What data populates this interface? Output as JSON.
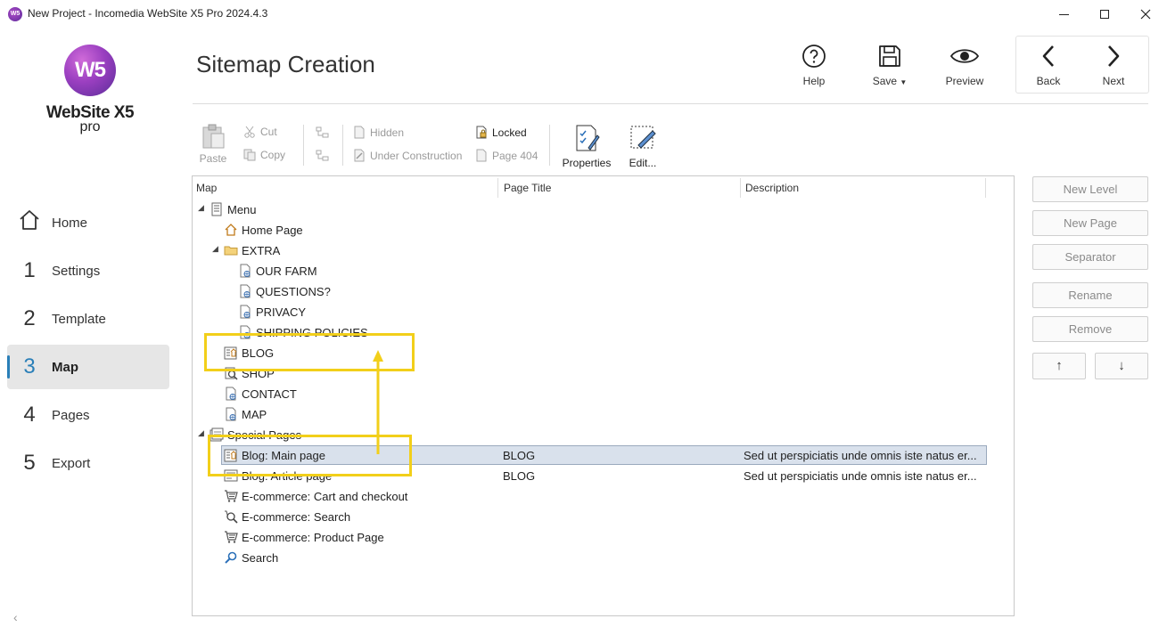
{
  "window": {
    "title": "New Project - Incomedia WebSite X5 Pro 2024.4.3",
    "app_icon": "W5"
  },
  "logo": {
    "mark": "W5",
    "name": "WebSite X5",
    "edition": "pro"
  },
  "nav": [
    {
      "num": "",
      "label": "Home",
      "icon": "home-icon"
    },
    {
      "num": "1",
      "label": "Settings"
    },
    {
      "num": "2",
      "label": "Template"
    },
    {
      "num": "3",
      "label": "Map",
      "active": true
    },
    {
      "num": "4",
      "label": "Pages"
    },
    {
      "num": "5",
      "label": "Export"
    }
  ],
  "header": {
    "title": "Sitemap Creation",
    "help": "Help",
    "save": "Save",
    "preview": "Preview",
    "back": "Back",
    "next": "Next"
  },
  "toolbar": {
    "paste": "Paste",
    "cut": "Cut",
    "copy": "Copy",
    "hidden": "Hidden",
    "under_construction": "Under Construction",
    "locked": "Locked",
    "page404": "Page 404",
    "properties": "Properties",
    "edit": "Edit..."
  },
  "tree": {
    "columns": [
      "Map",
      "Page Title",
      "Description"
    ],
    "rows": [
      {
        "label": "Menu",
        "title": "",
        "desc": "",
        "icon": "menu-root-icon",
        "twisty": true
      },
      {
        "label": "Home Page",
        "title": "",
        "desc": "",
        "icon": "home-page-icon"
      },
      {
        "label": "EXTRA",
        "title": "",
        "desc": "",
        "icon": "folder-icon",
        "twisty": true
      },
      {
        "label": "OUR FARM",
        "title": "",
        "desc": "",
        "icon": "page-icon"
      },
      {
        "label": "QUESTIONS?",
        "title": "",
        "desc": "",
        "icon": "page-icon"
      },
      {
        "label": "PRIVACY",
        "title": "",
        "desc": "",
        "icon": "page-icon"
      },
      {
        "label": "SHIPPING POLICIES",
        "title": "",
        "desc": "",
        "icon": "page-icon"
      },
      {
        "label": "BLOG",
        "title": "",
        "desc": "",
        "icon": "blog-page-icon"
      },
      {
        "label": "SHOP",
        "title": "",
        "desc": "",
        "icon": "shop-page-icon"
      },
      {
        "label": "CONTACT",
        "title": "",
        "desc": "",
        "icon": "page-icon"
      },
      {
        "label": "MAP",
        "title": "",
        "desc": "",
        "icon": "page-icon"
      },
      {
        "label": "Special Pages",
        "title": "",
        "desc": "",
        "icon": "special-pages-icon",
        "twisty": true
      },
      {
        "label": "Blog: Main page",
        "title": "BLOG",
        "desc": "Sed ut perspiciatis unde omnis iste natus er...",
        "icon": "blog-page-icon",
        "selected": true
      },
      {
        "label": "Blog: Article page",
        "title": "BLOG",
        "desc": "Sed ut perspiciatis unde omnis iste natus er...",
        "icon": "article-page-icon"
      },
      {
        "label": "E-commerce: Cart and checkout",
        "title": "",
        "desc": "",
        "icon": "cart-icon"
      },
      {
        "label": "E-commerce: Search",
        "title": "",
        "desc": "",
        "icon": "search-page-icon"
      },
      {
        "label": "E-commerce: Product Page",
        "title": "",
        "desc": "",
        "icon": "cart-icon"
      },
      {
        "label": "Search",
        "title": "",
        "desc": "",
        "icon": "magnifier-icon"
      }
    ]
  },
  "side_buttons": {
    "new_level": "New Level",
    "new_page": "New Page",
    "separator": "Separator",
    "rename": "Rename",
    "remove": "Remove",
    "up": "↑",
    "down": "↓"
  },
  "colors": {
    "accent": "#2a7fb8",
    "highlight": "#f2cf1a",
    "selection": "#d9e1ec"
  }
}
